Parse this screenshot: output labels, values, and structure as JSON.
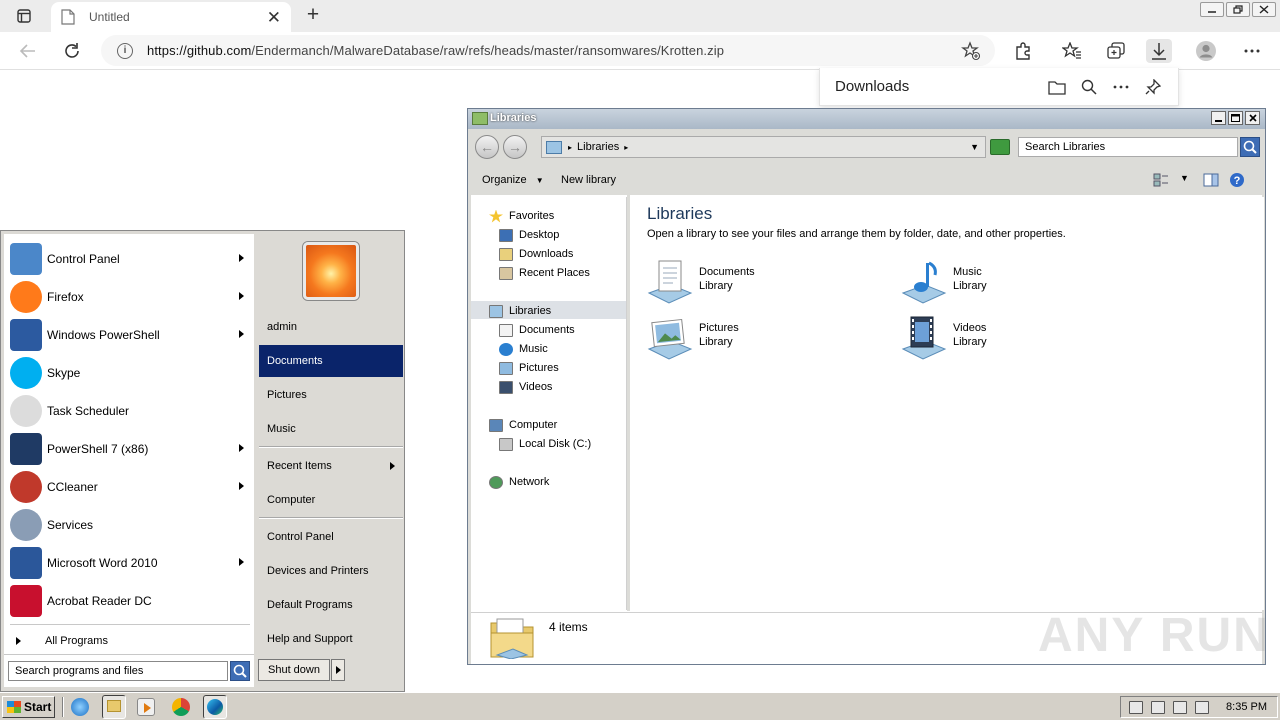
{
  "browser": {
    "tab_title": "Untitled",
    "url_host": "https://github.com",
    "url_path": "/Endermanch/MalwareDatabase/raw/refs/heads/master/ransomwares/Krotten.zip"
  },
  "downloads_panel": {
    "title": "Downloads"
  },
  "explorer": {
    "window_title": "Libraries",
    "breadcrumb": "Libraries",
    "search_placeholder": "Search Libraries",
    "toolbar": {
      "organize": "Organize",
      "new_library": "New library"
    },
    "tree": {
      "favorites": "Favorites",
      "desktop": "Desktop",
      "downloads": "Downloads",
      "recent_places": "Recent Places",
      "libraries": "Libraries",
      "documents": "Documents",
      "music": "Music",
      "pictures": "Pictures",
      "videos": "Videos",
      "computer": "Computer",
      "local_disk": "Local Disk (C:)",
      "network": "Network"
    },
    "heading": "Libraries",
    "description": "Open a library to see your files and arrange them by folder, date, and other properties.",
    "libraries": [
      {
        "name": "Documents",
        "kind": "Library"
      },
      {
        "name": "Music",
        "kind": "Library"
      },
      {
        "name": "Pictures",
        "kind": "Library"
      },
      {
        "name": "Videos",
        "kind": "Library"
      }
    ],
    "status_count": "4 items"
  },
  "start_menu": {
    "programs": [
      {
        "label": "Control Panel",
        "arrow": true
      },
      {
        "label": "Firefox",
        "arrow": true
      },
      {
        "label": "Windows PowerShell",
        "arrow": true
      },
      {
        "label": "Skype",
        "arrow": false
      },
      {
        "label": "Task Scheduler",
        "arrow": false
      },
      {
        "label": "PowerShell 7 (x86)",
        "arrow": true
      },
      {
        "label": "CCleaner",
        "arrow": true
      },
      {
        "label": "Services",
        "arrow": false
      },
      {
        "label": "Microsoft Word 2010",
        "arrow": true
      },
      {
        "label": "Acrobat Reader DC",
        "arrow": false
      }
    ],
    "all_programs": "All Programs",
    "search_placeholder": "Search programs and files",
    "right": {
      "user": "admin",
      "documents": "Documents",
      "pictures": "Pictures",
      "music": "Music",
      "recent_items": "Recent Items",
      "computer": "Computer",
      "control_panel": "Control Panel",
      "devices_printers": "Devices and Printers",
      "default_programs": "Default Programs",
      "help_support": "Help and Support"
    },
    "shutdown": "Shut down"
  },
  "taskbar": {
    "start": "Start",
    "clock": "8:35 PM"
  },
  "watermark": "ANY RUN"
}
